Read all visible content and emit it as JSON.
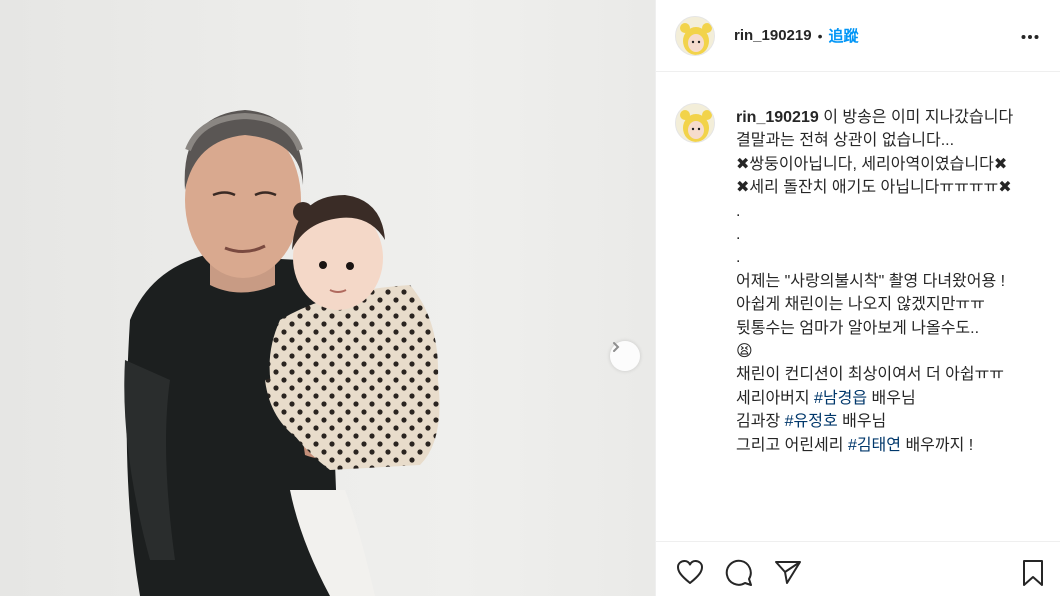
{
  "post": {
    "username": "rin_190219",
    "separator": "•",
    "follow_label": "追蹤"
  },
  "caption": {
    "username": "rin_190219",
    "lines": [
      "이 방송은 이미 지나갔습니다",
      "결말과는 전혀 상관이 없습니다...",
      "✖쌍둥이아닙니다, 세리아역이였습니다✖",
      "✖세리 돌잔치 애기도 아닙니다ㅠㅠㅠㅠ✖",
      ".",
      ".",
      ".",
      "어제는 \"사랑의불시착\" 촬영 다녀왔어용 !",
      "아쉽게 채린이는 나오지 않겠지만ㅠㅠ",
      "뒷통수는 엄마가 알아보게 나올수도..",
      "😫",
      "채린이 컨디션이 최상이여서 더 아쉽ㅠㅠ"
    ],
    "credit_1_prefix": "세리아버지 ",
    "credit_1_tag": "#남경읍",
    "credit_1_suffix": " 배우님",
    "credit_2_prefix": "김과장 ",
    "credit_2_tag": "#유정호",
    "credit_2_suffix": " 배우님",
    "credit_3_prefix": "그리고 어린세리 ",
    "credit_3_tag": "#김태연",
    "credit_3_suffix": " 배우까지 !"
  },
  "icons": {
    "more": "more-dots-icon",
    "next": "chevron-right-icon",
    "like": "heart-icon",
    "comment": "comment-icon",
    "share": "share-icon",
    "save": "bookmark-icon"
  },
  "colors": {
    "link": "#0095f6",
    "hashtag": "#00376b",
    "text": "#262626",
    "border": "#efefef"
  }
}
